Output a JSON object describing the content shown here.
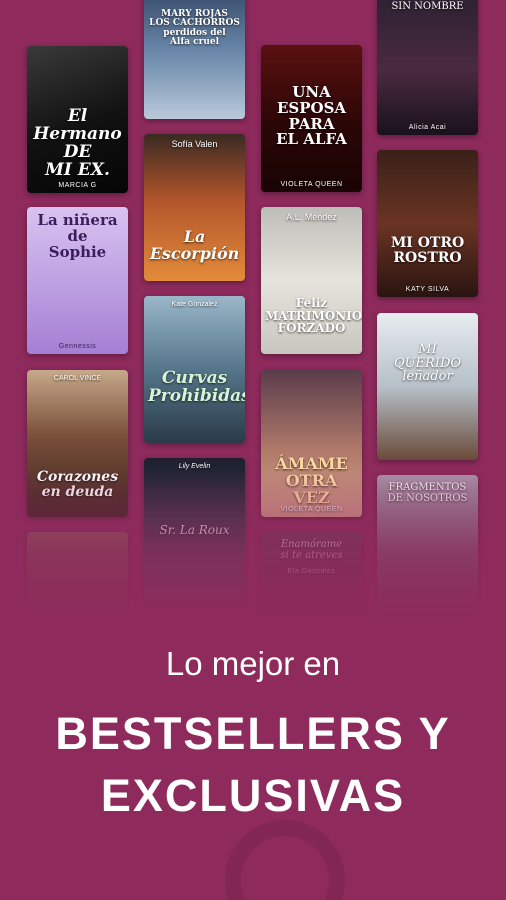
{
  "covers": [
    {
      "title": "MARY ROJAS\nLOS CACHORROS\nperdidos del\nAlfa cruel",
      "author": ""
    },
    {
      "title": "SIN NOMBRE",
      "author": "Alicia Acai"
    },
    {
      "title": "El Hermano\nDE\nMI EX.",
      "author": "MARCIA G"
    },
    {
      "title": "UNA\nESPOSA\nPARA\nEL ALFA",
      "author": "VIOLETA QUEEN"
    },
    {
      "title": "La\nEscorpión",
      "author": "Sofía Valen"
    },
    {
      "title": "MI OTRO\nROSTRO",
      "author": "KATY SILVA"
    },
    {
      "title": "La niñera de\nSophie",
      "author": "Gennessis"
    },
    {
      "title": "Feliz\nMATRIMONIO\nFORZADO",
      "author": "A.L. Méndez"
    },
    {
      "title": "Curvas\nProhibidas",
      "author": "Kate Gonzalez"
    },
    {
      "title": "MI\nQUERIDO\nleñador",
      "author": ""
    },
    {
      "title": "Corazones\nen deuda",
      "author": "CAROL VINCE"
    },
    {
      "title": "ÁMAME\nOTRA\nVEZ",
      "author": "VIOLETA QUEEN"
    },
    {
      "title": "Sr. La Roux",
      "author": "Lily Evelin"
    },
    {
      "title": "FRAGMENTOS\nDE NOSOTROS",
      "author": ""
    },
    {
      "title": "",
      "author": ""
    },
    {
      "title": "Enamórame\nsi te atreves",
      "author": "Ela González"
    }
  ],
  "promo": {
    "subtitle": "Lo mejor en",
    "headline_line1": "BESTSELLERS Y",
    "headline_line2": "EXCLUSIVAS"
  },
  "colors": {
    "background": "#8e2a5c",
    "text": "#ffffff"
  }
}
